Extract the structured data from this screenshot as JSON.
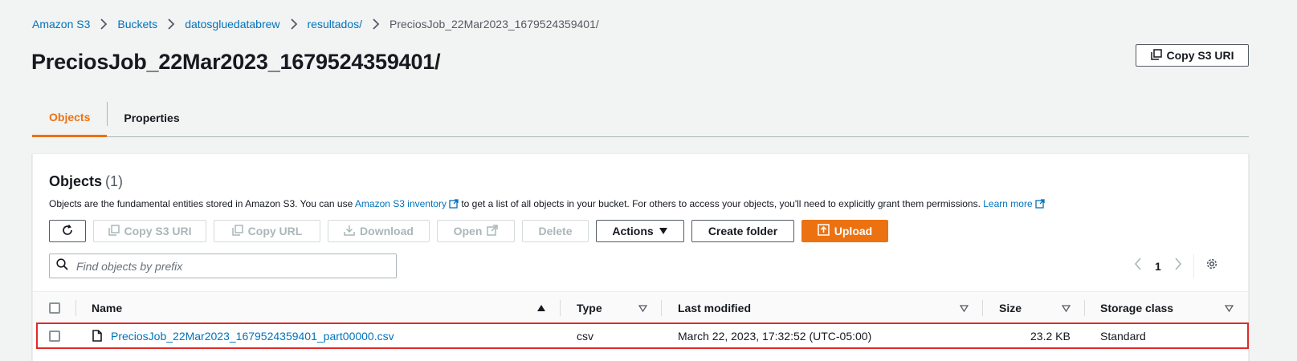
{
  "breadcrumb": {
    "items": [
      "Amazon S3",
      "Buckets",
      "datosgluedatabrew",
      "resultados/"
    ],
    "current": "PreciosJob_22Mar2023_1679524359401/"
  },
  "page": {
    "title": "PreciosJob_22Mar2023_1679524359401/",
    "copy_uri_label": "Copy S3 URI"
  },
  "tabs": [
    {
      "label": "Objects",
      "active": true
    },
    {
      "label": "Properties",
      "active": false
    }
  ],
  "objects_panel": {
    "title": "Objects",
    "count": "(1)",
    "desc_before": "Objects are the fundamental entities stored in Amazon S3. You can use ",
    "desc_link1": "Amazon S3 inventory",
    "desc_middle": " to get a list of all objects in your bucket. For others to access your objects, you'll need to explicitly grant them permissions. ",
    "desc_link2": "Learn more"
  },
  "toolbar": {
    "copy_s3_uri": "Copy S3 URI",
    "copy_url": "Copy URL",
    "download": "Download",
    "open": "Open",
    "delete": "Delete",
    "actions": "Actions",
    "create_folder": "Create folder",
    "upload": "Upload"
  },
  "search": {
    "placeholder": "Find objects by prefix",
    "value": ""
  },
  "pagination": {
    "current_page": "1"
  },
  "table": {
    "columns": [
      "Name",
      "Type",
      "Last modified",
      "Size",
      "Storage class"
    ],
    "rows": [
      {
        "name": "PreciosJob_22Mar2023_1679524359401_part00000.csv",
        "type": "csv",
        "last_modified": "March 22, 2023, 17:32:52 (UTC-05:00)",
        "size": "23.2 KB",
        "storage_class": "Standard"
      }
    ]
  },
  "colors": {
    "link": "#0073bb",
    "accent_orange": "#ec7211",
    "highlight_border": "#e02a2a",
    "page_bg": "#f2f3f3"
  },
  "icons": [
    "chevron-right-icon",
    "copy-icon",
    "refresh-icon",
    "download-icon",
    "external-link-icon",
    "caret-down-icon",
    "upload-icon",
    "search-icon",
    "chevron-left-icon",
    "settings-gear-icon",
    "sort-ascending-icon",
    "sort-descending-icon",
    "file-icon"
  ]
}
